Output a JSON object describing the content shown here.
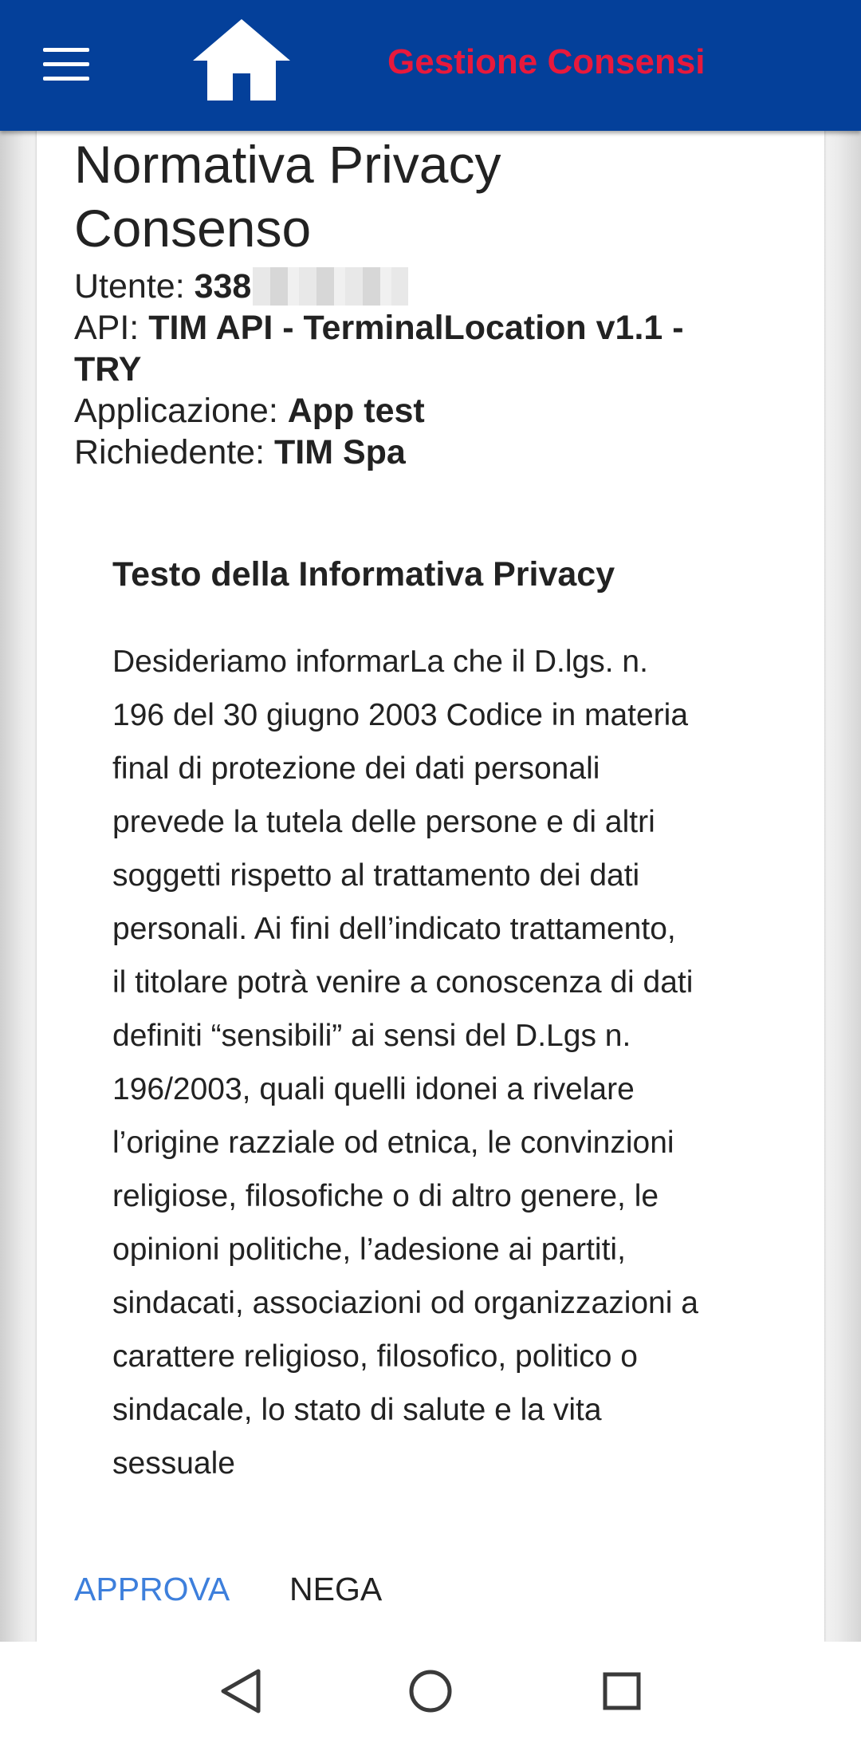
{
  "header": {
    "menu_icon": "hamburger-menu-icon",
    "home_icon": "home-icon",
    "title": "Gestione Consensi",
    "background_color": "#04409a",
    "title_color": "#e8193c"
  },
  "consent": {
    "title_line1": "Normativa Privacy",
    "title_line2": "Consenso",
    "user_label": "Utente: ",
    "user_value": "338",
    "api_label": "API: ",
    "api_value_line1": "TIM API - TerminalLocation v1.1 -",
    "api_value_line2": "TRY",
    "app_label": "Applicazione: ",
    "app_value": "App test",
    "requester_label": "Richiedente: ",
    "requester_value": "TIM Spa"
  },
  "policy": {
    "heading": "Testo della Informativa Privacy",
    "lines": [
      "Desideriamo informarLa che il D.lgs. n.",
      "196 del 30 giugno 2003 Codice in materia",
      "final di protezione dei dati personali",
      "prevede la tutela delle persone e di altri",
      "soggetti rispetto al trattamento dei dati",
      "personali. Ai fini dell’indicato trattamento,",
      "il titolare potrà venire a conoscenza di dati",
      "definiti “sensibili” ai sensi del D.Lgs n.",
      "196/2003, quali quelli idonei a rivelare",
      "l’origine razziale od etnica, le convinzioni",
      "religiose, filosofiche o di altro genere, le",
      "opinioni politiche, l’adesione ai partiti,",
      "sindacati, associazioni od organizzazioni a",
      "carattere religioso, filosofico, politico o",
      "sindacale, lo stato di salute e la vita",
      "sessuale"
    ]
  },
  "actions": {
    "approve_label": "APPROVA",
    "deny_label": "NEGA",
    "approve_color": "#3d7fdc"
  },
  "navigation": {
    "back_icon": "back-triangle-icon",
    "home_icon": "home-circle-icon",
    "recents_icon": "recents-square-icon"
  }
}
